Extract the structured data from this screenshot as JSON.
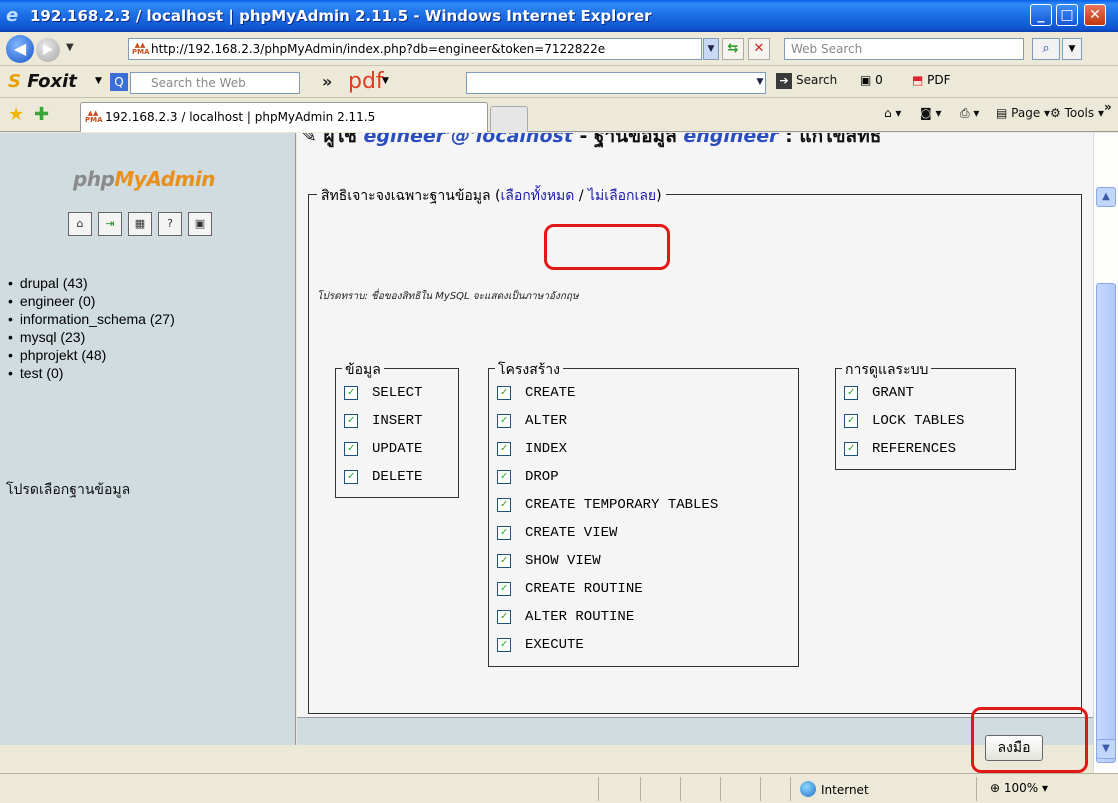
{
  "window": {
    "title": "192.168.2.3 / localhost | phpMyAdmin 2.11.5 - Windows Internet Explorer",
    "controls": {
      "minimize": "_",
      "maximize": "□",
      "close": "✕"
    }
  },
  "navbar": {
    "url": "http://192.168.2.3/phpMyAdmin/index.php?db=engineer&token=7122822e",
    "web_search_placeholder": "Web Search"
  },
  "foxit_toolbar": {
    "brand": "Foxit",
    "search_placeholder": "Search the Web",
    "chevron": "»",
    "pdf_label": "pdf",
    "search_button": "Search",
    "count": "0",
    "pdf_button": "PDF"
  },
  "tabbar": {
    "tab_title": "192.168.2.3 / localhost | phpMyAdmin 2.11.5",
    "commands": {
      "page": "Page",
      "tools": "Tools"
    }
  },
  "sidebar": {
    "logo": {
      "php": "php",
      "my": "My",
      "admin": "Admin"
    },
    "icons": [
      "home-icon",
      "exit-icon",
      "sql-icon",
      "help-icon",
      "query-window-icon"
    ],
    "databases": [
      "drupal (43)",
      "engineer (0)",
      "information_schema (27)",
      "mysql (23)",
      "phprojekt (48)",
      "test (0)"
    ],
    "hint": "โปรดเลือกฐานข้อมูล"
  },
  "main": {
    "heading": {
      "prefix": "ผู้ใช้ ",
      "user": "egineer'@'localhost",
      "middle": " - ฐานข้อมูล ",
      "db": "engineer",
      "suffix": " : แก้ไขสิทธิ"
    },
    "legend": {
      "text": "สิทธิเจาะจงเฉพาะฐานข้อมูล (",
      "select_all": "เลือกทั้งหมด",
      "sep": " / ",
      "select_none": "ไม่เลือกเลย",
      "close": ")"
    },
    "note": "โปรดทราบ: ชื่อของสิทธิใน MySQL จะแสดงเป็นภาษาอังกฤษ",
    "groups": [
      {
        "title": "ข้อมูล",
        "privileges": [
          "SELECT",
          "INSERT",
          "UPDATE",
          "DELETE"
        ]
      },
      {
        "title": "โครงสร้าง",
        "privileges": [
          "CREATE",
          "ALTER",
          "INDEX",
          "DROP",
          "CREATE TEMPORARY TABLES",
          "CREATE VIEW",
          "SHOW VIEW",
          "CREATE ROUTINE",
          "ALTER ROUTINE",
          "EXECUTE"
        ]
      },
      {
        "title": "การดูแลระบบ",
        "privileges": [
          "GRANT",
          "LOCK TABLES",
          "REFERENCES"
        ]
      }
    ],
    "go_button": "ลงมือ",
    "checkmark": "✓"
  },
  "statusbar": {
    "zone": "Internet",
    "zoom": "100%"
  },
  "colors": {
    "highlight": "#e21818",
    "sidebar_bg": "#D0DCE0",
    "title_bar": "#0A5EE7"
  }
}
